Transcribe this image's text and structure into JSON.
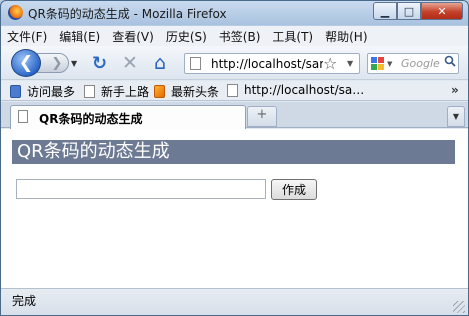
{
  "window": {
    "title": "QR条码的动态生成 - Mozilla Firefox",
    "controls": {
      "minimize": "▁",
      "maximize": "□",
      "close": "✕"
    }
  },
  "menu": {
    "items": [
      {
        "label": "文件(F)"
      },
      {
        "label": "编辑(E)"
      },
      {
        "label": "查看(V)"
      },
      {
        "label": "历史(S)"
      },
      {
        "label": "书签(B)"
      },
      {
        "label": "工具(T)"
      },
      {
        "label": "帮助(H)"
      }
    ]
  },
  "navbar": {
    "back_icon": "❮",
    "forward_icon": "❯",
    "dropdown": "▼",
    "reload_icon": "↻",
    "stop_icon": "✕",
    "home_icon": "⌂",
    "url": "http://localhost/sar",
    "star_icon": "☆",
    "search_placeholder": "Google",
    "search_icon": "🔍"
  },
  "bookmarks": {
    "items": [
      {
        "label": "访问最多",
        "icon": "bookmark-icon"
      },
      {
        "label": "新手上路",
        "icon": "page-icon"
      },
      {
        "label": "最新头条",
        "icon": "rss-icon"
      },
      {
        "label": "http://localhost/sa…",
        "icon": "page-icon"
      }
    ],
    "more": "»"
  },
  "tabs": {
    "active_label": "QR条码的动态生成",
    "new_tab": "+",
    "list": "▼"
  },
  "page": {
    "heading": "QR条码的动态生成",
    "input_value": "",
    "button_label": "作成"
  },
  "status": {
    "text": "完成"
  },
  "colors": {
    "heading_bg": "#6d7a93",
    "close_button": "#c4412a"
  }
}
